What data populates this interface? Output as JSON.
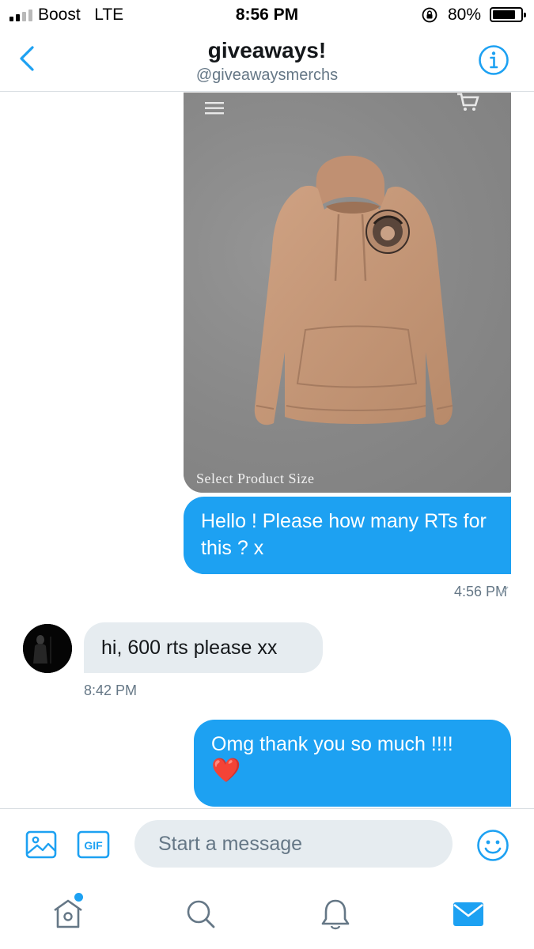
{
  "status_bar": {
    "carrier": "Boost",
    "network": "LTE",
    "time": "8:56 PM",
    "battery_percent": "80%",
    "battery_level": 0.8,
    "signal_bars": 2
  },
  "header": {
    "title": "giveaways!",
    "handle": "@giveawaysmerchs",
    "back_icon": "chevron-left-icon",
    "info_icon": "info-icon"
  },
  "product_image": {
    "caption": "Select Product Size",
    "alt": "tan hoodie with vintage print"
  },
  "messages": [
    {
      "direction": "outgoing",
      "text": "Hello ! Please how many RTs for this ? x",
      "time": "4:56 PM",
      "status": "sent"
    },
    {
      "direction": "incoming",
      "text": "hi, 600 rts please xx",
      "time": "8:42 PM"
    },
    {
      "direction": "outgoing",
      "text": "Omg thank you so much !!!!",
      "emoji": "❤️"
    }
  ],
  "composer": {
    "placeholder": "Start a message",
    "gif_label": "GIF"
  },
  "tabbar": {
    "items": [
      "home",
      "search",
      "notifications",
      "messages"
    ],
    "active": "messages",
    "home_has_dot": true
  },
  "colors": {
    "accent": "#1da1f2",
    "bubble_incoming": "#e6ecf0",
    "text_secondary": "#657786",
    "heart": "#e0245e"
  }
}
